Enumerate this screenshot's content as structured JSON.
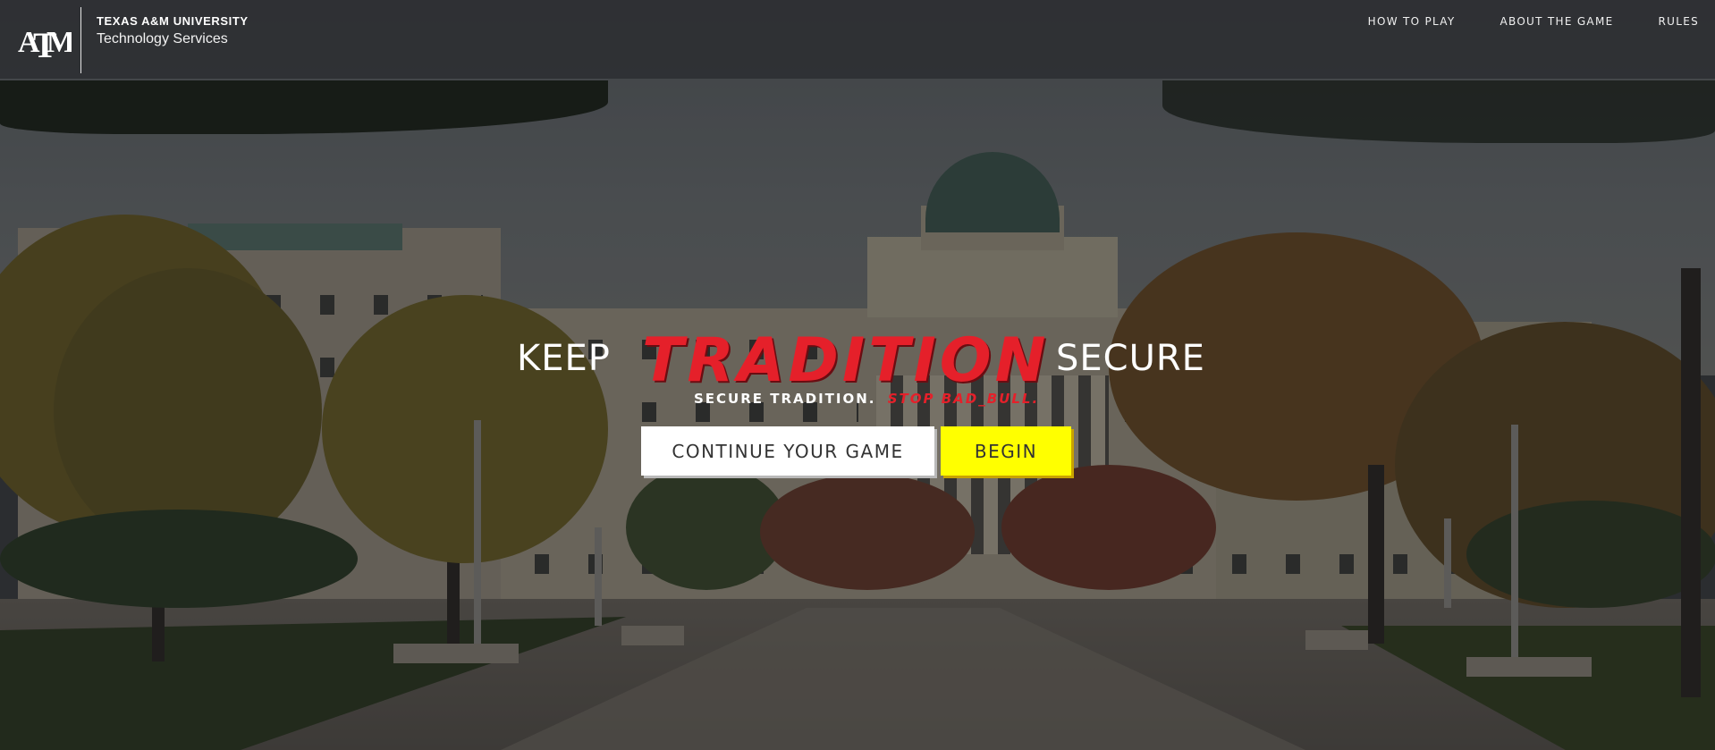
{
  "header": {
    "university": "TEXAS A&M UNIVERSITY",
    "department": "Technology Services",
    "logo_text": "ATM"
  },
  "nav": {
    "items": [
      {
        "label": "HOW TO PLAY"
      },
      {
        "label": "ABOUT THE GAME"
      },
      {
        "label": "RULES"
      }
    ]
  },
  "hero": {
    "word_left": "KEEP",
    "word_center": "TRADITION",
    "word_right": "SECURE",
    "tagline_main": "SECURE TRADITION.",
    "tagline_accent": "STOP BAD_BULL."
  },
  "buttons": {
    "continue_label": "CONTINUE YOUR GAME",
    "begin_label": "BEGIN"
  },
  "colors": {
    "accent_red": "#e5202a",
    "begin_yellow": "#ffff00",
    "header_bg": "#2a2c2f"
  }
}
